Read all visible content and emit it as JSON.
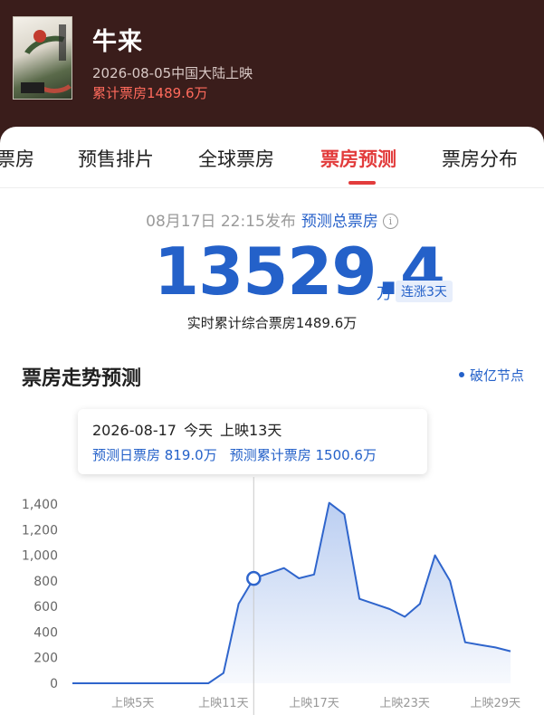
{
  "movie": {
    "title": "牛来",
    "release_info": "2026-08-05中国大陆上映",
    "cumulative": "累计票房1489.6万"
  },
  "tabs": [
    {
      "label": "票房",
      "active": false
    },
    {
      "label": "预售排片",
      "active": false
    },
    {
      "label": "全球票房",
      "active": false
    },
    {
      "label": "票房预测",
      "active": true
    },
    {
      "label": "票房分布",
      "active": false
    }
  ],
  "forecast": {
    "publish_time": "08月17日 22:15发布",
    "label": "预测总票房",
    "total": "13529.4",
    "unit": "万",
    "trend_badge": "连涨3天",
    "realtime_text": "实时累计综合票房1489.6万"
  },
  "trend": {
    "title": "票房走势预测",
    "legend": "破亿节点"
  },
  "tooltip": {
    "date": "2026-08-17",
    "today": "今天",
    "day": "上映13天",
    "daily": "预测日票房 819.0万",
    "cumulative": "预测累计票房 1500.6万"
  },
  "colors": {
    "header_bg": "#3a1d1b",
    "accent_red": "#e23c3c",
    "accent_blue": "#2461c9"
  },
  "chart_data": {
    "type": "area",
    "x": [
      1,
      2,
      3,
      4,
      5,
      6,
      7,
      8,
      9,
      10,
      11,
      12,
      13,
      14,
      15,
      16,
      17,
      18,
      19,
      20,
      21,
      22,
      23,
      24,
      25,
      26,
      27,
      28,
      29,
      30
    ],
    "y": [
      0,
      0,
      0,
      0,
      0,
      0,
      0,
      0,
      0,
      0,
      80,
      620,
      819,
      860,
      900,
      820,
      850,
      1410,
      1320,
      660,
      620,
      580,
      520,
      620,
      1000,
      800,
      320,
      300,
      280,
      250
    ],
    "x_tick_labels": [
      "上映5天",
      "上映11天",
      "上映17天",
      "上映23天",
      "上映29天"
    ],
    "x_tick_days": [
      5,
      11,
      17,
      23,
      29
    ],
    "y_ticks": [
      0,
      200,
      400,
      600,
      800,
      1000,
      1200,
      1400
    ],
    "y_tick_labels": [
      "0",
      "200",
      "400",
      "600",
      "800",
      "1,000",
      "1,200",
      "1,400"
    ],
    "ylim": [
      0,
      1400
    ],
    "highlight_day": 13,
    "grid": false
  }
}
